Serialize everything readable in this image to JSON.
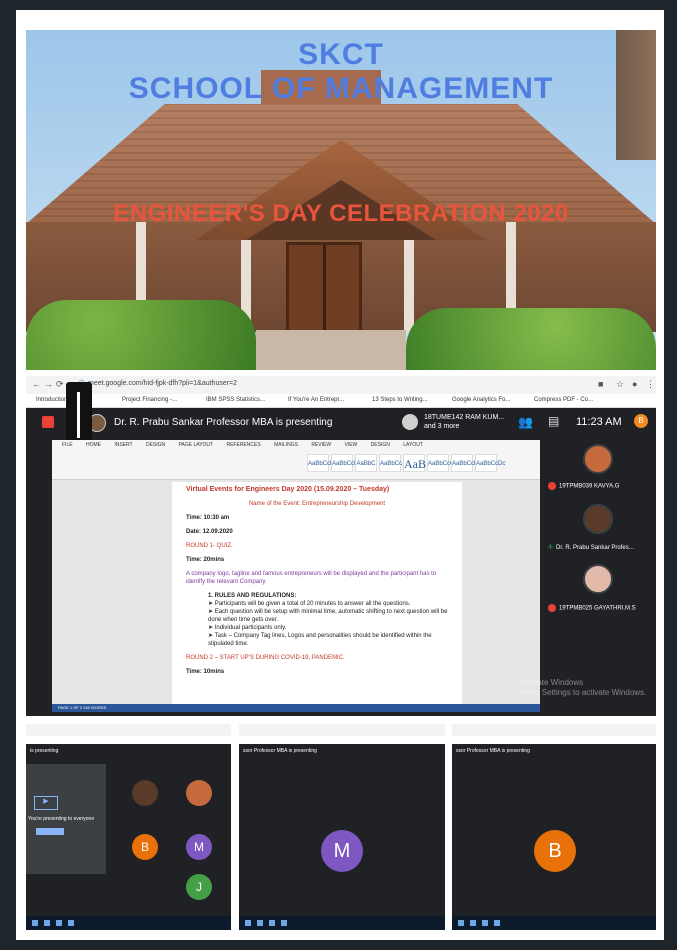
{
  "hero": {
    "line1": "SKCT",
    "line2": "SCHOOL OF MANAGEMENT",
    "event": "ENGINEER'S DAY  CELEBRATION 2020"
  },
  "browser": {
    "url": "meet.google.com/hid-fjpk-dfh?pli=1&authuser=2",
    "bookmarks": [
      "Introduction to Pro...",
      "Project Financing -...",
      "IBM SPSS Statistics...",
      "If You're An Entrepr...",
      "13 Steps to Writing...",
      "Google Analytics Fo...",
      "Compress PDF - Co..."
    ]
  },
  "meet": {
    "presenting": "Dr. R. Prabu Sankar Professor MBA is presenting",
    "joiner_line1": "18TUME142 RAM KUM...",
    "joiner_line2": "and 3 more",
    "time": "11:23 AM",
    "you_initial": "B",
    "participants": [
      {
        "name": "19TPMB039 KAVYA.G",
        "status": "muted"
      },
      {
        "name": "Dr. R. Prabu Sankar Profes...",
        "status": "speaking"
      },
      {
        "name": "19TPMB025 GAYATHRI.M.S",
        "status": "muted"
      }
    ],
    "activate_line1": "Activate Windows",
    "activate_line2": "Go to Settings to activate Windows."
  },
  "word": {
    "tabs": [
      "FILE",
      "HOME",
      "INSERT",
      "DESIGN",
      "PAGE LAYOUT",
      "REFERENCES",
      "MAILINGS",
      "REVIEW",
      "VIEW",
      "DESIGN",
      "LAYOUT"
    ],
    "styles": [
      "AaBbCcDc",
      "AaBbCcDc",
      "AaBbC",
      "AaBbCc",
      "AaB",
      "AaBbCcC",
      "AaBbCcDc",
      "AaBbCcDc"
    ],
    "status": "PAGE 1 OF 2    240 WORDS",
    "doc": {
      "heading": "Virtual Events for Engineers Day 2020 (15.09.2020 – Tuesday)",
      "event_name": "Name of the Event: Entrepreneurship Development",
      "time": "Time: 10:30 am",
      "date": "Date: 12.09.2020",
      "round1": "ROUND 1- QUIZ.",
      "time2": "Time: 20mins",
      "desc": "A company logo, tagline and famous entrepreneurs will be displayed and the participant has to identify the relevant Company.",
      "rules_title": "1.  RULES AND REGULATIONS:",
      "rules": [
        "➤  Participants will be given a total of 20 minutes to answer all the questions.",
        "➤  Each question will be setup with minimal time, automatic shifting to next question will be done when time gets over.",
        "➤  Individual participants only.",
        "➤  Task – Company Tag lines, Logos and personalities should be identified within the stipulated time."
      ],
      "round2": "ROUND 2 – START UP'S DURING COVID-19, PANDEMIC.",
      "time3": "Time: 10mins"
    }
  },
  "thumbs": {
    "t1_presenting": "is presenting",
    "t1_box": "▶",
    "t1_text": "You're presenting to everyone",
    "t1_initials": [
      "B",
      "M",
      "J"
    ],
    "t2_presenting": "ssor Professor MBA is presenting",
    "t2_initial": "M",
    "t3_presenting": "ssor Professor MBA is presenting",
    "t3_initial": "B"
  },
  "colors": {
    "hero_title": "#4f7ee0",
    "hero_event": "#e8543c",
    "meet_bg": "#202124",
    "avatar_orange": "#e8710a",
    "avatar_purple": "#7e57c2",
    "avatar_green": "#43a047"
  }
}
